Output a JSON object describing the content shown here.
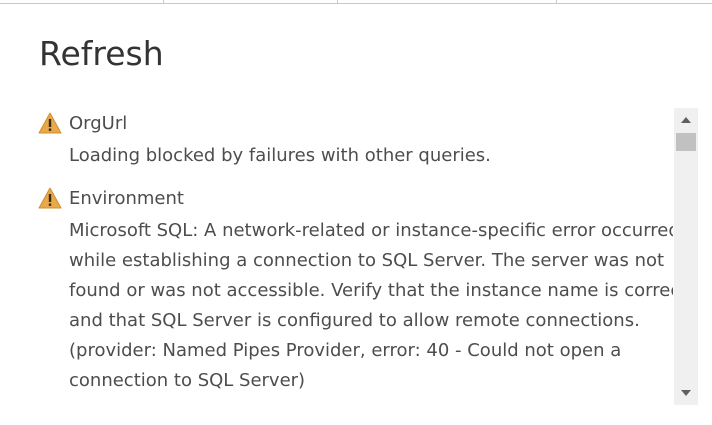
{
  "dialog": {
    "title": "Refresh"
  },
  "messages": [
    {
      "icon": "warning-icon",
      "query": "OrgUrl",
      "lines": [
        "Loading blocked by failures with other queries."
      ]
    },
    {
      "icon": "warning-icon",
      "query": "Environment",
      "lines": [
        "Microsoft SQL: A network-related or instance-specific error occurred",
        "while establishing a connection to SQL Server. The server was not",
        "found or was not accessible. Verify that the instance name is correct",
        "and that SQL Server is configured to allow remote connections.",
        "(provider: Named Pipes Provider, error: 40 - Could not open a",
        "connection to SQL Server)"
      ]
    }
  ],
  "colors": {
    "warning_fill": "#e8a94a",
    "warning_mark": "#3a2a10",
    "text": "#4d4d4d",
    "title": "#333333"
  },
  "scrollbar": {
    "up_icon": "scroll-up-arrow-icon",
    "down_icon": "scroll-down-arrow-icon"
  }
}
